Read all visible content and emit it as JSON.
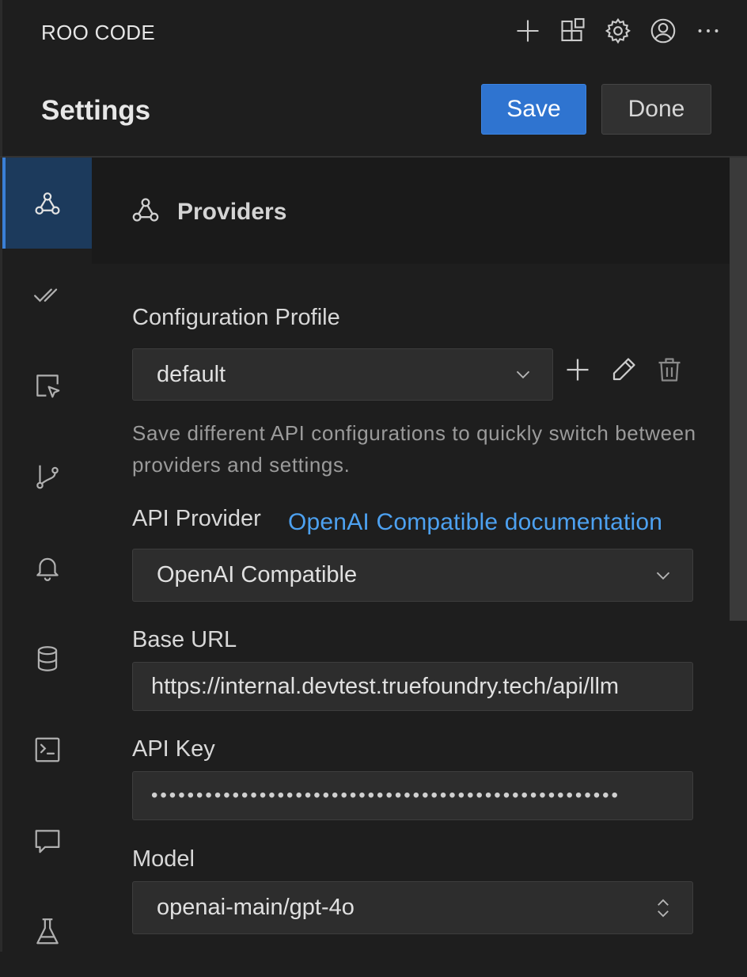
{
  "app": {
    "title": "ROO CODE"
  },
  "titlebar_icons": [
    "plus-icon",
    "extensions-icon",
    "gear-icon",
    "account-icon",
    "more-icon"
  ],
  "settings": {
    "title": "Settings",
    "save_label": "Save",
    "done_label": "Done"
  },
  "sidebar": {
    "items": [
      {
        "icon": "webhook-icon",
        "active": true
      },
      {
        "icon": "check-all-icon"
      },
      {
        "icon": "browser-cursor-icon"
      },
      {
        "icon": "git-branch-icon"
      },
      {
        "icon": "bell-icon"
      },
      {
        "icon": "database-icon"
      },
      {
        "icon": "terminal-icon"
      },
      {
        "icon": "comment-icon"
      },
      {
        "icon": "beaker-icon"
      }
    ]
  },
  "section": {
    "title": "Providers"
  },
  "profile": {
    "label": "Configuration Profile",
    "value": "default",
    "description": "Save different API configurations to quickly switch between providers and settings."
  },
  "provider": {
    "label": "API Provider",
    "doc_link": "OpenAI Compatible documentation",
    "value": "OpenAI Compatible"
  },
  "base_url": {
    "label": "Base URL",
    "value": "https://internal.devtest.truefoundry.tech/api/llm"
  },
  "api_key": {
    "label": "API Key",
    "masked_value": "••••••••••••••••••••••••••••••••••••••••••••••••••••"
  },
  "model": {
    "label": "Model",
    "value": "openai-main/gpt-4o"
  },
  "colors": {
    "accent": "#2f74d0",
    "link": "#4da1f0",
    "background": "#1e1e1e",
    "active_nav": "#1c3a5c"
  }
}
